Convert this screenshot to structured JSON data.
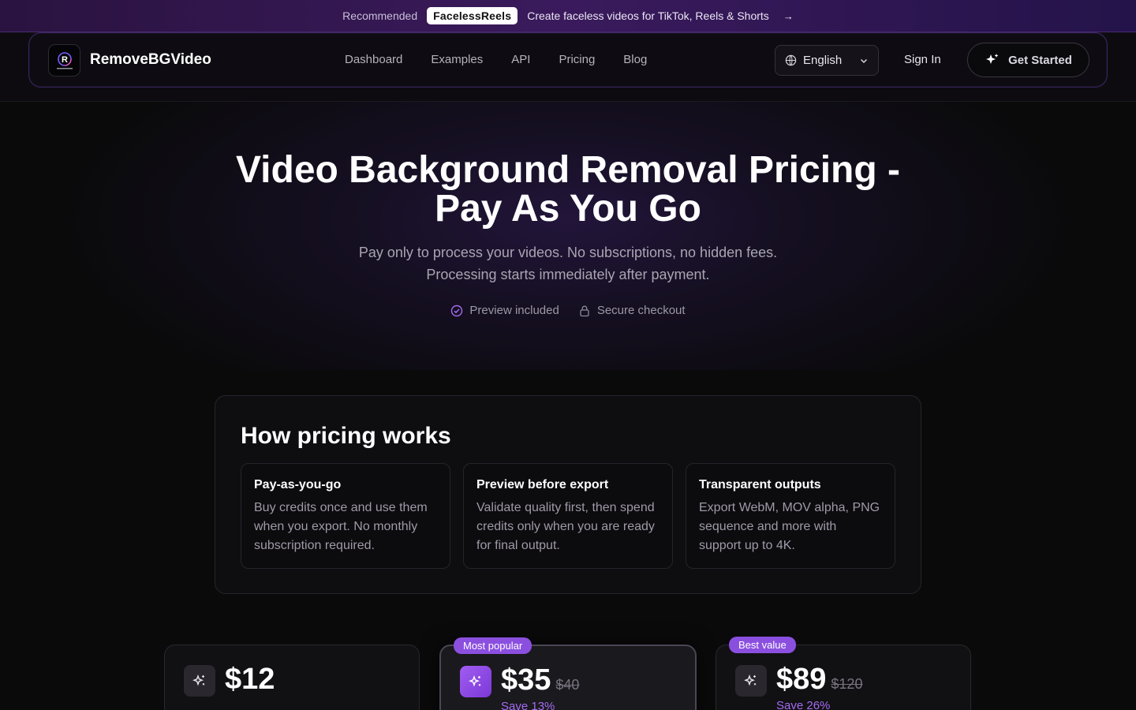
{
  "promo": {
    "recommended": "Recommended",
    "brand": "FacelessReels",
    "message": "Create faceless videos for TikTok, Reels & Shorts",
    "arrow": "→"
  },
  "nav": {
    "logo_name": "RemoveBGVideo",
    "links": [
      "Dashboard",
      "Examples",
      "API",
      "Pricing",
      "Blog"
    ],
    "language": "English",
    "sign_in": "Sign In",
    "get_started": "Get Started"
  },
  "hero": {
    "title_line1": "Video Background Removal Pricing -",
    "title_line2": "Pay As You Go",
    "subtitle_line1": "Pay only to process your videos. No subscriptions, no hidden fees.",
    "subtitle_line2": "Processing starts immediately after payment.",
    "trust": [
      "Preview included",
      "Secure checkout"
    ]
  },
  "how": {
    "title": "How pricing works",
    "cards": [
      {
        "title": "Pay-as-you-go",
        "desc": "Buy credits once and use them when you export. No monthly subscription required."
      },
      {
        "title": "Preview before export",
        "desc": "Validate quality first, then spend credits only when you are ready for final output."
      },
      {
        "title": "Transparent outputs",
        "desc": "Export WebM, MOV alpha, PNG sequence and more with support up to 4K."
      }
    ]
  },
  "plans": [
    {
      "price": "$12",
      "old": "",
      "save": "",
      "badge": ""
    },
    {
      "price": "$35",
      "old": "$40",
      "save": "Save 13%",
      "badge": "Most popular"
    },
    {
      "price": "$89",
      "old": "$120",
      "save": "Save 26%",
      "badge": "Best value"
    }
  ],
  "colors": {
    "accent": "#8b4fe0",
    "background": "#0a0a0b",
    "promo_bg": "#3a1a5c"
  }
}
